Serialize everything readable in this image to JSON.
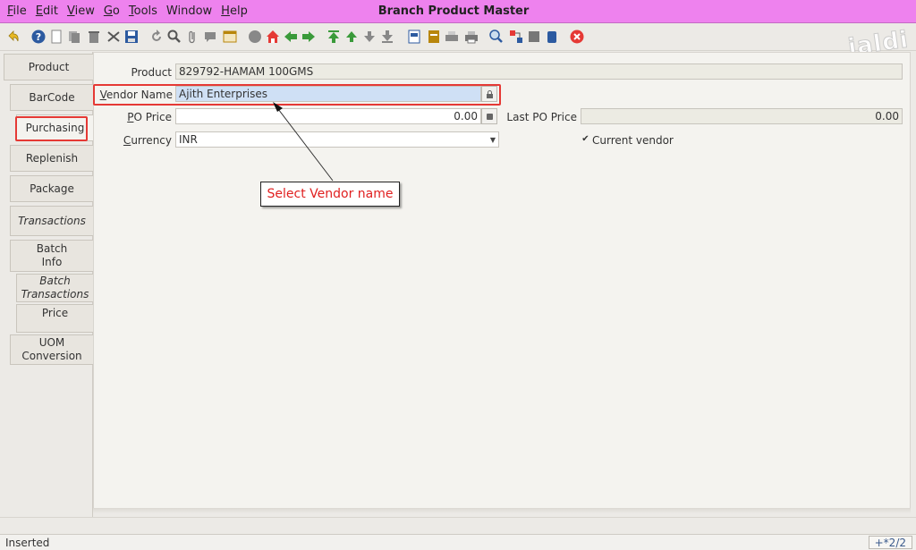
{
  "window": {
    "title": "Branch Product Master"
  },
  "menu": [
    {
      "label": "File",
      "key": "F",
      "rest": "ile"
    },
    {
      "label": "Edit",
      "key": "E",
      "rest": "dit"
    },
    {
      "label": "View",
      "key": "V",
      "rest": "iew"
    },
    {
      "label": "Go",
      "key": "G",
      "rest": "o"
    },
    {
      "label": "Tools",
      "key": "T",
      "rest": "ools"
    },
    {
      "label": "Window",
      "key": "",
      "rest": "Window"
    },
    {
      "label": "Help",
      "key": "H",
      "rest": "elp"
    }
  ],
  "watermark": "jaldi",
  "tabs": [
    {
      "label": "Product"
    },
    {
      "label": "BarCode"
    },
    {
      "label": "Purchasing"
    },
    {
      "label": "Replenish"
    },
    {
      "label": "Package"
    },
    {
      "label": "Transactions"
    },
    {
      "label": "Batch Info"
    },
    {
      "label": "Batch Transactions"
    },
    {
      "label": "Price"
    },
    {
      "label": "UOM Conversion"
    }
  ],
  "form": {
    "product_label": "Product",
    "product_value": "829792-HAMAM 100GMS",
    "vendor_label_key": "V",
    "vendor_label_rest": "endor Name",
    "vendor_value": "Ajith Enterprises",
    "po_price_label_key": "P",
    "po_price_label_rest": "O Price",
    "po_price_value": "0.00",
    "last_po_price_label": "Last PO Price",
    "last_po_price_value": "0.00",
    "currency_label_key": "C",
    "currency_label_rest": "urrency",
    "currency_value": "INR",
    "current_vendor_label": "Current vendor",
    "current_vendor_checked": true
  },
  "callout": {
    "text": "Select Vendor name"
  },
  "status": {
    "text": "Inserted",
    "record": "+*2/2"
  },
  "colors": {
    "titlebar": "#ee82ee",
    "highlight": "#e53935",
    "vendor_field": "#cfe0f5"
  }
}
